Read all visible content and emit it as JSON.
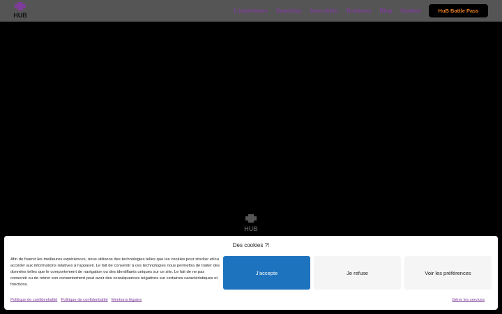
{
  "header": {
    "logo_text": "HUB",
    "nav": [
      {
        "label": "L'expérience"
      },
      {
        "label": "Snacking"
      },
      {
        "label": "Jeux vidéo"
      },
      {
        "label": "Business"
      },
      {
        "label": "Blog"
      },
      {
        "label": "Contact"
      }
    ],
    "cta_label": "HuB Battle Pass"
  },
  "hero": {
    "logo_text": "HUB"
  },
  "cookie_banner": {
    "title": "Des cookies ?!",
    "text": "Afin de fournir les meilleures expériences, nous utilisons des technologies telles que les cookies pour stocker et/ou accéder aux informations relatives à l'appareil. Le fait de consentir à ces technologies nous permettra de traiter des données telles que le comportement de navigation ou des identifiants uniques sur ce site. Le fait de ne pas consentir ou de retirer son consentement peut avoir des conséquences négatives sur certaines caractéristiques et fonctions.",
    "accept_label": "J'accepte",
    "refuse_label": "Je refuse",
    "prefs_label": "Voir les préférences",
    "links": [
      {
        "label": "Politique de confidentialité"
      },
      {
        "label": "Politique de confidentialité"
      },
      {
        "label": "Mentions légales"
      }
    ],
    "manage_label": "Gérer les services"
  },
  "colors": {
    "accent": "#7d3c98",
    "cta_text": "#e67e22",
    "accept_button": "#1e73be",
    "header_bg": "#555555"
  }
}
